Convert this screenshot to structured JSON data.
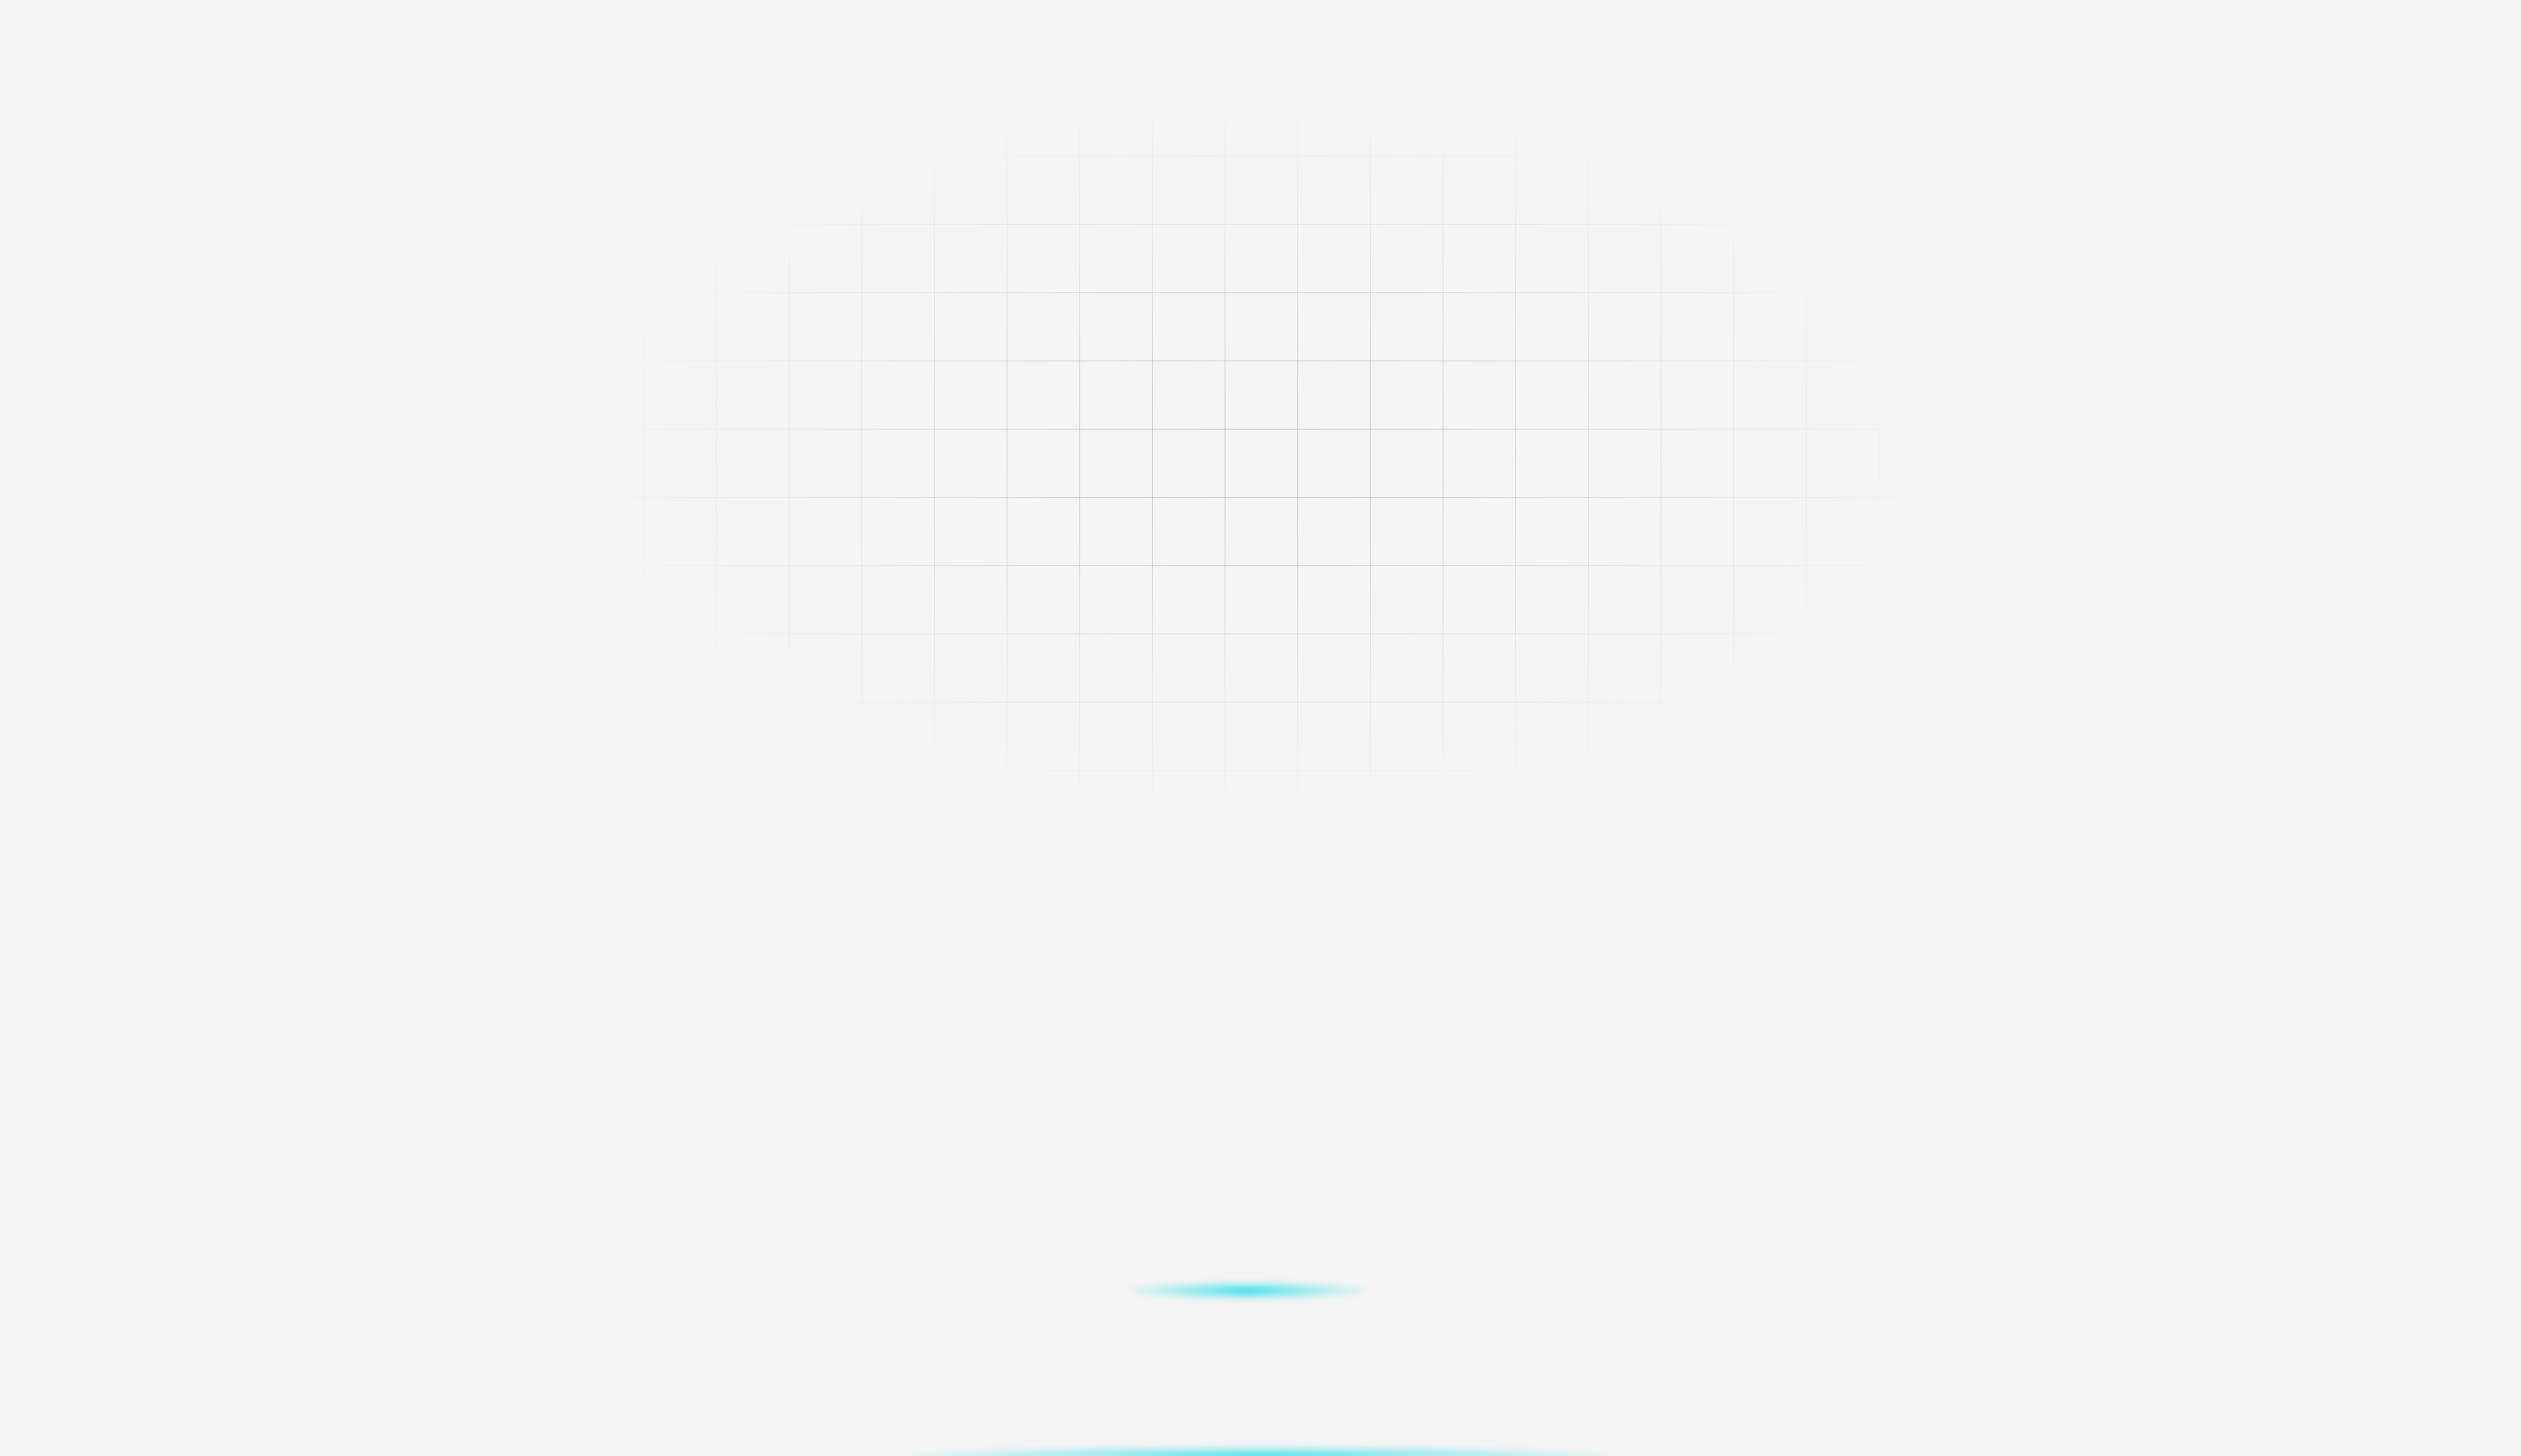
{
  "page": {
    "background_color": "#f5f5f5"
  },
  "grid": {
    "line_color": "#787878"
  },
  "accent": {
    "glow_color": "#26dee8"
  }
}
